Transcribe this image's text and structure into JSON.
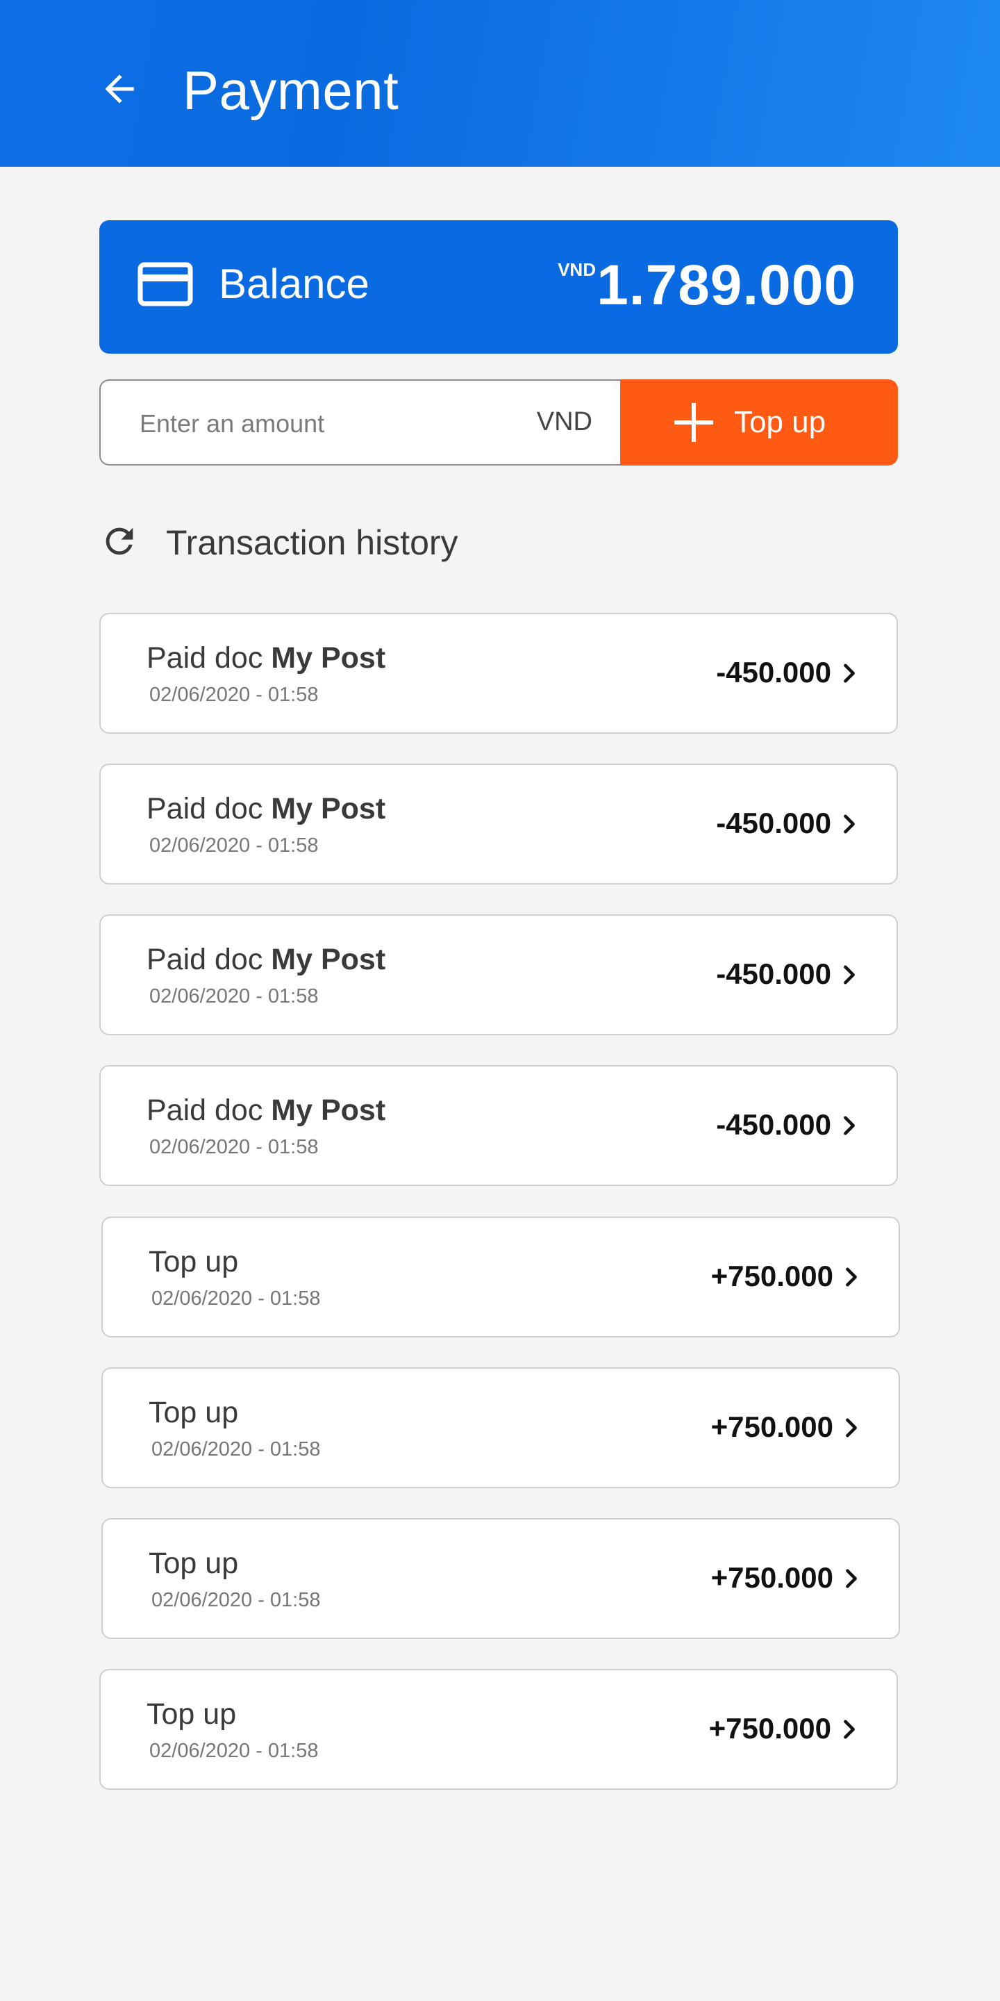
{
  "header": {
    "title": "Payment",
    "back_icon": "arrow-left-icon"
  },
  "balance": {
    "label": "Balance",
    "currency": "VND",
    "amount": "1.789.000",
    "icon": "credit-card-icon"
  },
  "topup": {
    "placeholder": "Enter an amount",
    "value": "",
    "unit": "VND",
    "button_label": "Top up",
    "button_icon": "plus-icon"
  },
  "history": {
    "title": "Transaction history",
    "icon": "refresh-icon",
    "items": [
      {
        "title_prefix": "Paid doc ",
        "title_bold": "My Post",
        "date": "02/06/2020 - 01:58",
        "amount": "-450.000"
      },
      {
        "title_prefix": "Paid doc ",
        "title_bold": "My Post",
        "date": "02/06/2020 - 01:58",
        "amount": "-450.000"
      },
      {
        "title_prefix": "Paid doc ",
        "title_bold": "My Post",
        "date": "02/06/2020 - 01:58",
        "amount": "-450.000"
      },
      {
        "title_prefix": "Paid doc ",
        "title_bold": "My Post",
        "date": "02/06/2020 - 01:58",
        "amount": "-450.000"
      },
      {
        "title_prefix": "Top up",
        "title_bold": "",
        "date": "02/06/2020 - 01:58",
        "amount": "+750.000"
      },
      {
        "title_prefix": "Top up",
        "title_bold": "",
        "date": "02/06/2020 - 01:58",
        "amount": "+750.000"
      },
      {
        "title_prefix": "Top up",
        "title_bold": "",
        "date": "02/06/2020 - 01:58",
        "amount": "+750.000"
      },
      {
        "title_prefix": "Top up",
        "title_bold": "",
        "date": "02/06/2020 - 01:58",
        "amount": "+750.000"
      }
    ]
  },
  "colors": {
    "primary": "#0a6ae2",
    "accent": "#ff5a14",
    "background": "#f4f4f4"
  }
}
